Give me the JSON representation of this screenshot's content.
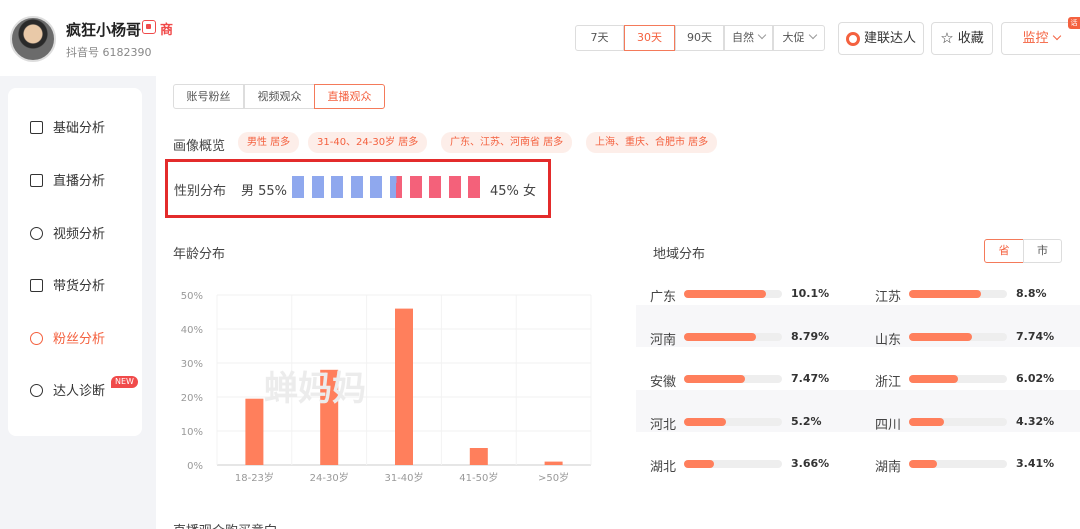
{
  "header": {
    "name": "疯狂小杨哥",
    "shop_badge": "商",
    "uid": "抖音号 6182390",
    "ranges": [
      "7天",
      "30天",
      "90天"
    ],
    "active_range": "30天",
    "filter_natural": "自然",
    "filter_promo": "大促",
    "connect_label": "建联达人",
    "favorite_label": "收藏",
    "monitor_label": "监控",
    "corner_tag": "话"
  },
  "sidebar": {
    "items": [
      {
        "label": "基础分析",
        "icon": "bar-chart-icon"
      },
      {
        "label": "直播分析",
        "icon": "live-icon"
      },
      {
        "label": "视频分析",
        "icon": "play-icon"
      },
      {
        "label": "带货分析",
        "icon": "bag-icon"
      },
      {
        "label": "粉丝分析",
        "icon": "fans-icon"
      },
      {
        "label": "达人诊断",
        "icon": "diagnose-icon"
      }
    ],
    "active": "粉丝分析",
    "new_tag": "NEW"
  },
  "main": {
    "tabs": [
      "账号粉丝",
      "视频观众",
      "直播观众"
    ],
    "active_tab": "直播观众",
    "portrait_title": "画像概览",
    "portrait_tags": [
      "男性 居多",
      "31-40、24-30岁 居多",
      "广东、江苏、河南省 居多",
      "上海、重庆、合肥市 居多"
    ],
    "gender": {
      "title": "性别分布",
      "male_label": "男 55%",
      "female_label": "45% 女",
      "male_share": 0.55,
      "colors": {
        "male": "#8fa8ee",
        "female": "#f4617a"
      }
    },
    "age_title": "年龄分布",
    "region": {
      "title": "地域分布",
      "toggle": [
        "省",
        "市"
      ],
      "active_toggle": "省",
      "rows": [
        [
          {
            "name": "广东",
            "value": "10.1%",
            "share": 10.1
          },
          {
            "name": "江苏",
            "value": "8.8%",
            "share": 8.8
          }
        ],
        [
          {
            "name": "河南",
            "value": "8.79%",
            "share": 8.79
          },
          {
            "name": "山东",
            "value": "7.74%",
            "share": 7.74
          }
        ],
        [
          {
            "name": "安徽",
            "value": "7.47%",
            "share": 7.47
          },
          {
            "name": "浙江",
            "value": "6.02%",
            "share": 6.02
          }
        ],
        [
          {
            "name": "河北",
            "value": "5.2%",
            "share": 5.2
          },
          {
            "name": "四川",
            "value": "4.32%",
            "share": 4.32
          }
        ],
        [
          {
            "name": "湖北",
            "value": "3.66%",
            "share": 3.66
          },
          {
            "name": "湖南",
            "value": "3.41%",
            "share": 3.41
          }
        ]
      ]
    },
    "bottom_title": "直播观众购买意向",
    "watermark": "蝉妈妈"
  },
  "chart_data": {
    "type": "bar",
    "categories": [
      "18-23岁",
      "24-30岁",
      "31-40岁",
      "41-50岁",
      ">50岁"
    ],
    "values": [
      19.5,
      28,
      46,
      5,
      1
    ],
    "yticks": [
      "0%",
      "10%",
      "20%",
      "30%",
      "40%",
      "50%"
    ],
    "ylim": [
      0,
      50
    ],
    "color": "#ff7f5c",
    "grid": true
  }
}
